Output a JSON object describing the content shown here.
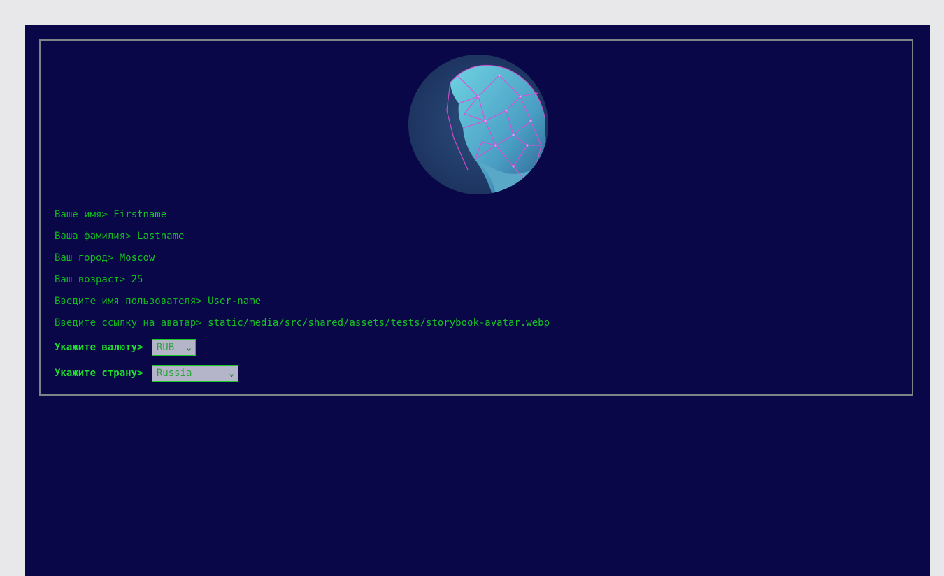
{
  "profile": {
    "avatar_icon": "statue-avatar-image",
    "fields": [
      {
        "label": "Ваше имя>",
        "value": "Firstname"
      },
      {
        "label": "Ваша фамилия>",
        "value": "Lastname"
      },
      {
        "label": "Ваш город>",
        "value": "Moscow"
      },
      {
        "label": "Ваш возраст>",
        "value": "25"
      },
      {
        "label": "Введите имя пользователя>",
        "value": "User-name"
      },
      {
        "label": "Введите ссылку на аватар>",
        "value": "static/media/src/shared/assets/tests/storybook-avatar.webp"
      }
    ],
    "currency": {
      "label": "Укажите валюту>",
      "value": "RUB"
    },
    "country": {
      "label": "Укажите страну>",
      "value": "Russia"
    }
  },
  "colors": {
    "background": "#090748",
    "accent": "#1fe12b",
    "border": "#7d8487"
  }
}
